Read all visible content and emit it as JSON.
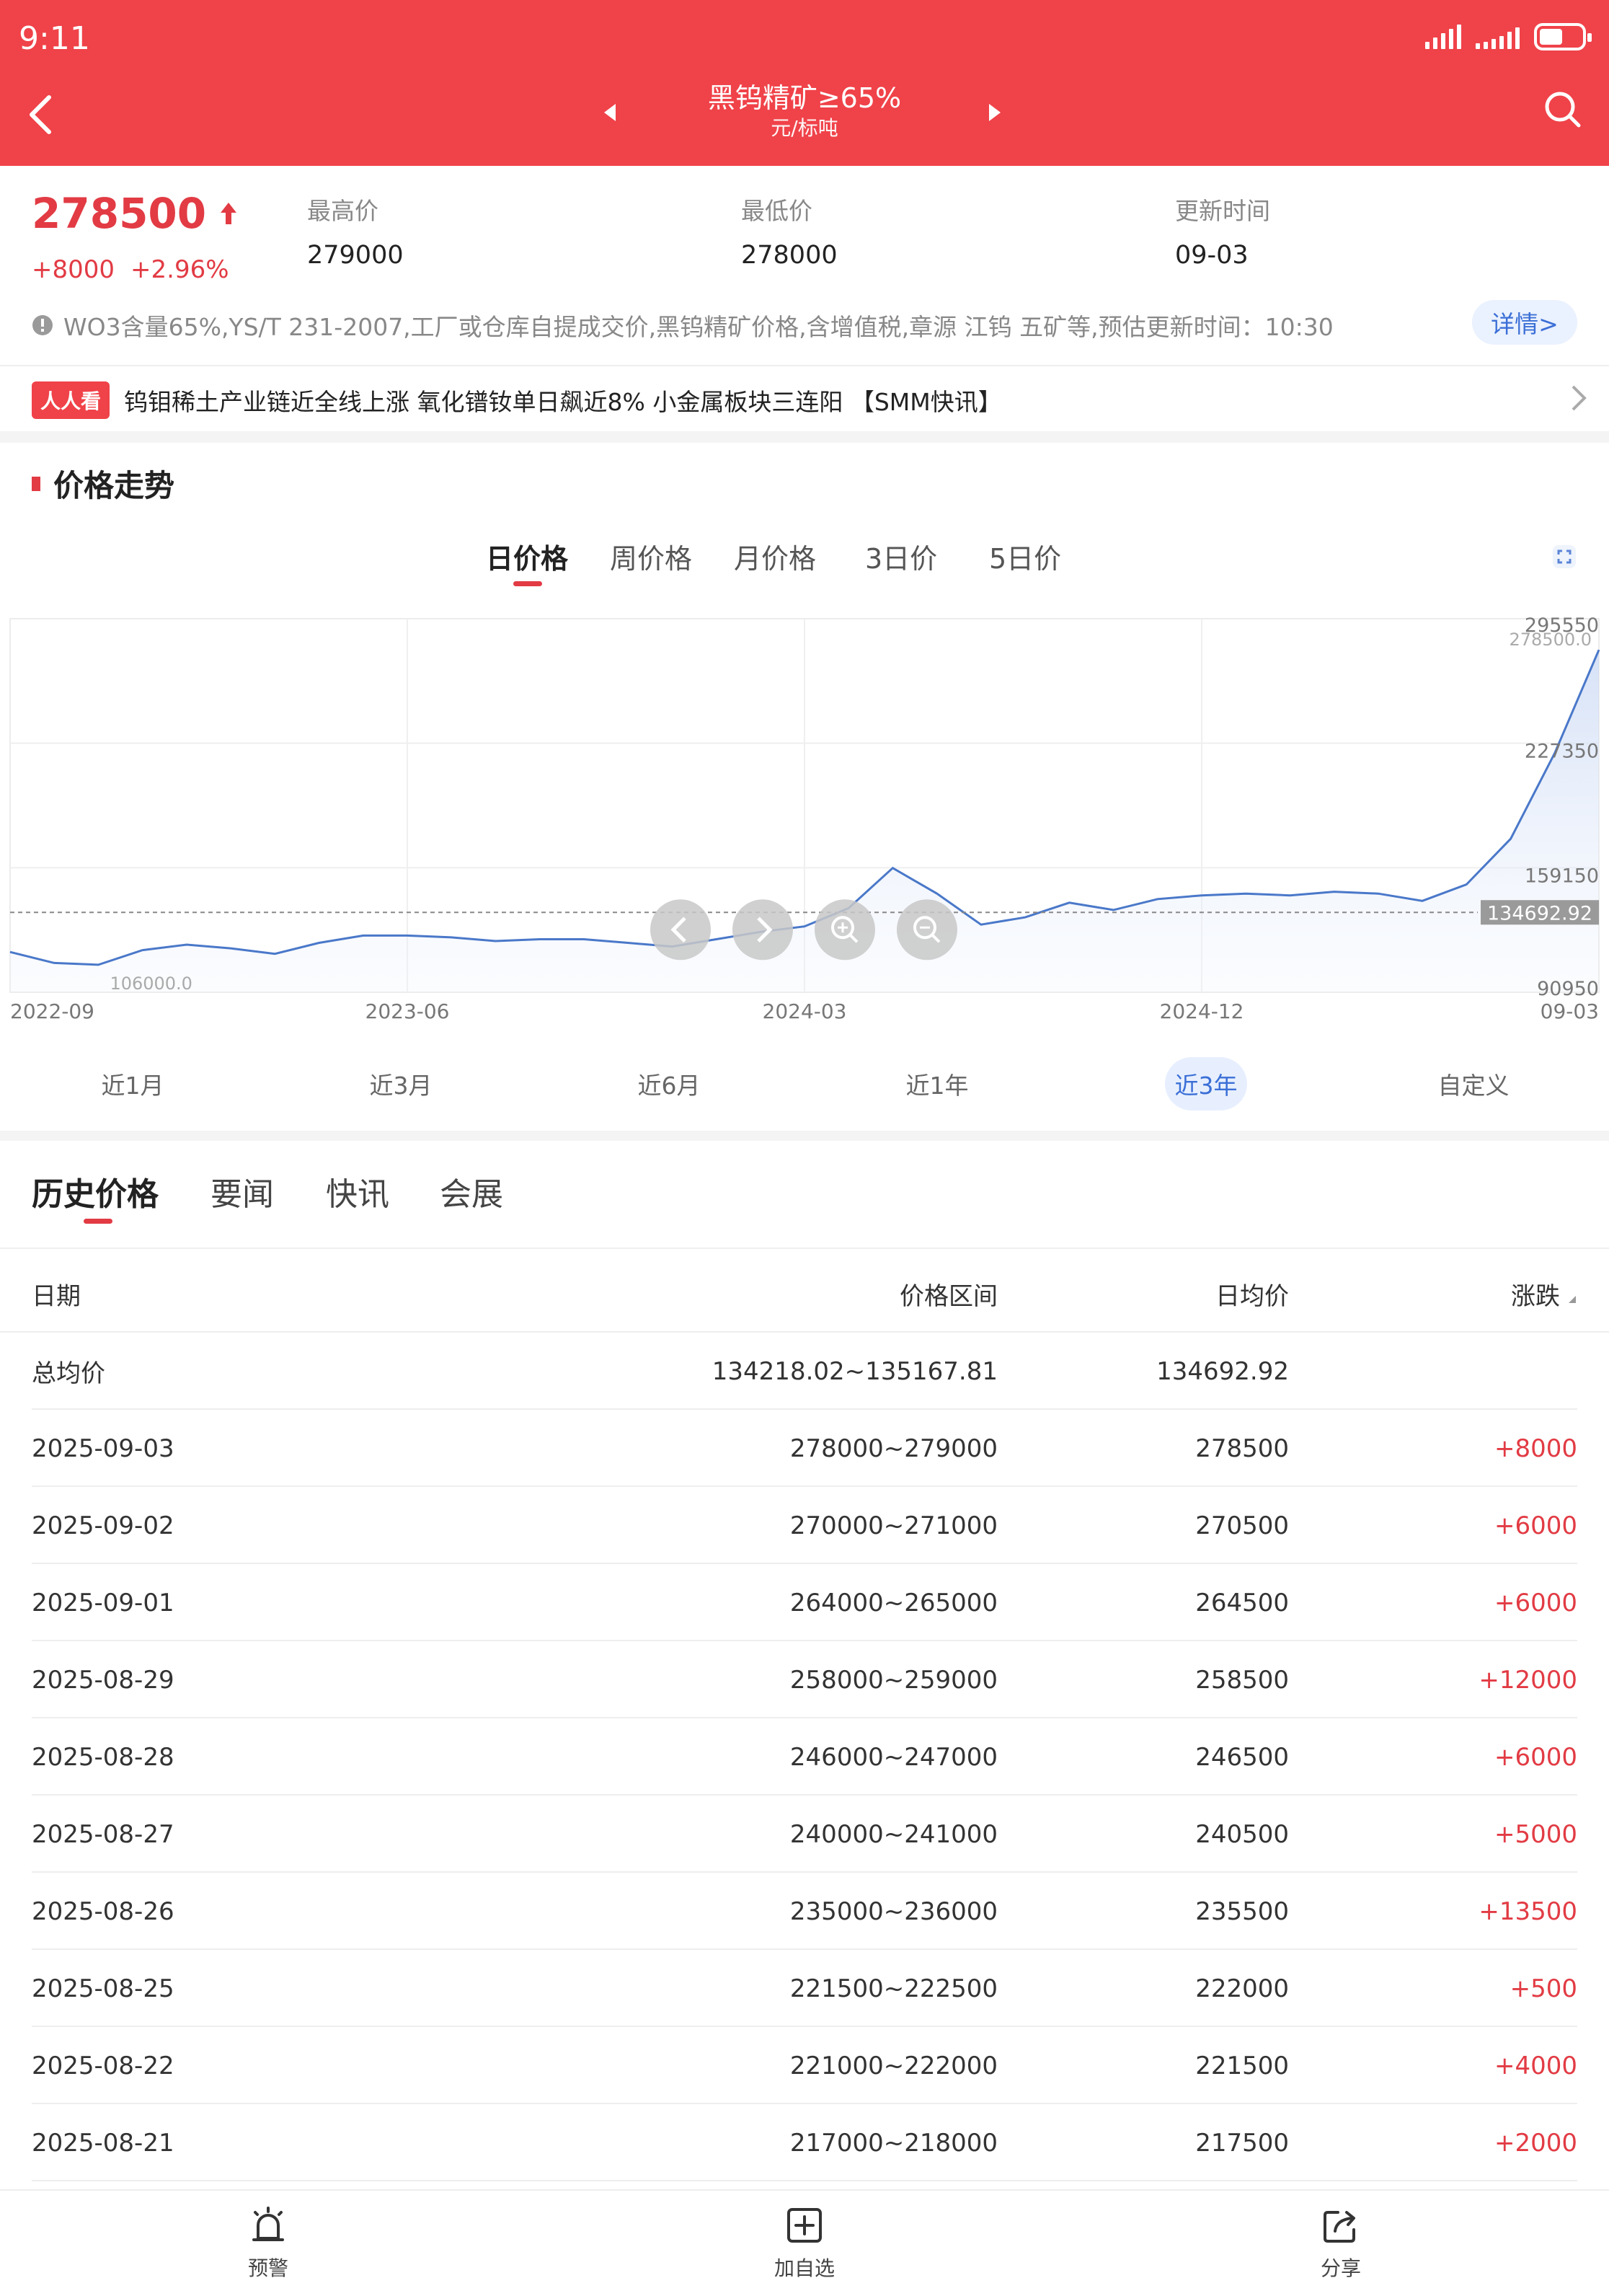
{
  "status_bar": {
    "time": "9:11"
  },
  "header": {
    "title": "黑钨精矿≥65%",
    "unit": "元/标吨"
  },
  "price": {
    "current": "278500",
    "change_abs": "+8000",
    "change_pct": "+2.96%",
    "high_label": "最高价",
    "high_value": "279000",
    "low_label": "最低价",
    "low_value": "278000",
    "update_label": "更新时间",
    "update_value": "09-03"
  },
  "notice": {
    "text": "WO3含量65%,YS/T 231-2007,工厂或仓库自提成交价,黑钨精矿价格,含增值税,章源 江钨 五矿等,预估更新时间：10:30",
    "detail_button": "详情>"
  },
  "news": {
    "badge": "人人看",
    "headline": "钨钼稀土产业链近全线上涨 氧化镨钕单日飙近8% 小金属板块三连阳 【SMM快讯】"
  },
  "trend_section": {
    "title": "价格走势"
  },
  "period_tabs": [
    "日价格",
    "周价格",
    "月价格",
    "3日价",
    "5日价"
  ],
  "range_buttons": [
    "近1月",
    "近3月",
    "近6月",
    "近1年",
    "近3年",
    "自定义"
  ],
  "chart_data": {
    "type": "area",
    "x_tick_labels": [
      "2022-09",
      "2023-06",
      "2024-03",
      "2024-12",
      "09-03"
    ],
    "y_tick_labels": [
      "295550",
      "227350",
      "159150",
      "90950"
    ],
    "ylim": [
      90950,
      295550
    ],
    "reference_line": {
      "label": "134692.92",
      "value": 134692.92
    },
    "max_marker": {
      "label": "278500.0",
      "value": 278500
    },
    "min_marker": {
      "label": "106000.0",
      "value": 106000
    },
    "grid": true,
    "color": "#4a78c9",
    "series": [
      {
        "x": [
          "2022-09",
          "2022-10",
          "2022-11",
          "2022-12",
          "2023-01",
          "2023-02",
          "2023-03",
          "2023-04",
          "2023-05",
          "2023-06",
          "2023-07",
          "2023-08",
          "2023-09",
          "2023-10",
          "2023-11",
          "2023-12",
          "2024-01",
          "2024-02",
          "2024-03",
          "2024-04",
          "2024-05",
          "2024-06",
          "2024-07",
          "2024-08",
          "2024-09",
          "2024-10",
          "2024-11",
          "2024-12",
          "2025-01",
          "2025-02",
          "2025-03",
          "2025-04",
          "2025-05",
          "2025-06",
          "2025-07",
          "2025-08",
          "2025-09"
        ],
        "values": [
          113000,
          107000,
          106000,
          114000,
          117000,
          115000,
          112000,
          118000,
          122000,
          122000,
          121000,
          119000,
          120000,
          120000,
          118000,
          116000,
          120000,
          124000,
          127000,
          137000,
          159000,
          145000,
          128000,
          132000,
          140000,
          136000,
          142000,
          144000,
          145000,
          144000,
          146000,
          145000,
          141000,
          150000,
          175000,
          222000,
          278500
        ]
      }
    ]
  },
  "content_tabs": [
    "历史价格",
    "要闻",
    "快讯",
    "会展"
  ],
  "table": {
    "headers": {
      "date": "日期",
      "range": "价格区间",
      "avg": "日均价",
      "change": "涨跌"
    },
    "summary": {
      "label": "总均价",
      "range": "134218.02~135167.81",
      "avg": "134692.92"
    },
    "rows": [
      {
        "date": "2025-09-03",
        "range": "278000~279000",
        "avg": "278500",
        "change": "+8000"
      },
      {
        "date": "2025-09-02",
        "range": "270000~271000",
        "avg": "270500",
        "change": "+6000"
      },
      {
        "date": "2025-09-01",
        "range": "264000~265000",
        "avg": "264500",
        "change": "+6000"
      },
      {
        "date": "2025-08-29",
        "range": "258000~259000",
        "avg": "258500",
        "change": "+12000"
      },
      {
        "date": "2025-08-28",
        "range": "246000~247000",
        "avg": "246500",
        "change": "+6000"
      },
      {
        "date": "2025-08-27",
        "range": "240000~241000",
        "avg": "240500",
        "change": "+5000"
      },
      {
        "date": "2025-08-26",
        "range": "235000~236000",
        "avg": "235500",
        "change": "+13500"
      },
      {
        "date": "2025-08-25",
        "range": "221500~222500",
        "avg": "222000",
        "change": "+500"
      },
      {
        "date": "2025-08-22",
        "range": "221000~222000",
        "avg": "221500",
        "change": "+4000"
      },
      {
        "date": "2025-08-21",
        "range": "217000~218000",
        "avg": "217500",
        "change": "+2000"
      }
    ]
  },
  "bottom_nav": {
    "alert": "预警",
    "watchlist": "加自选",
    "share": "分享"
  }
}
